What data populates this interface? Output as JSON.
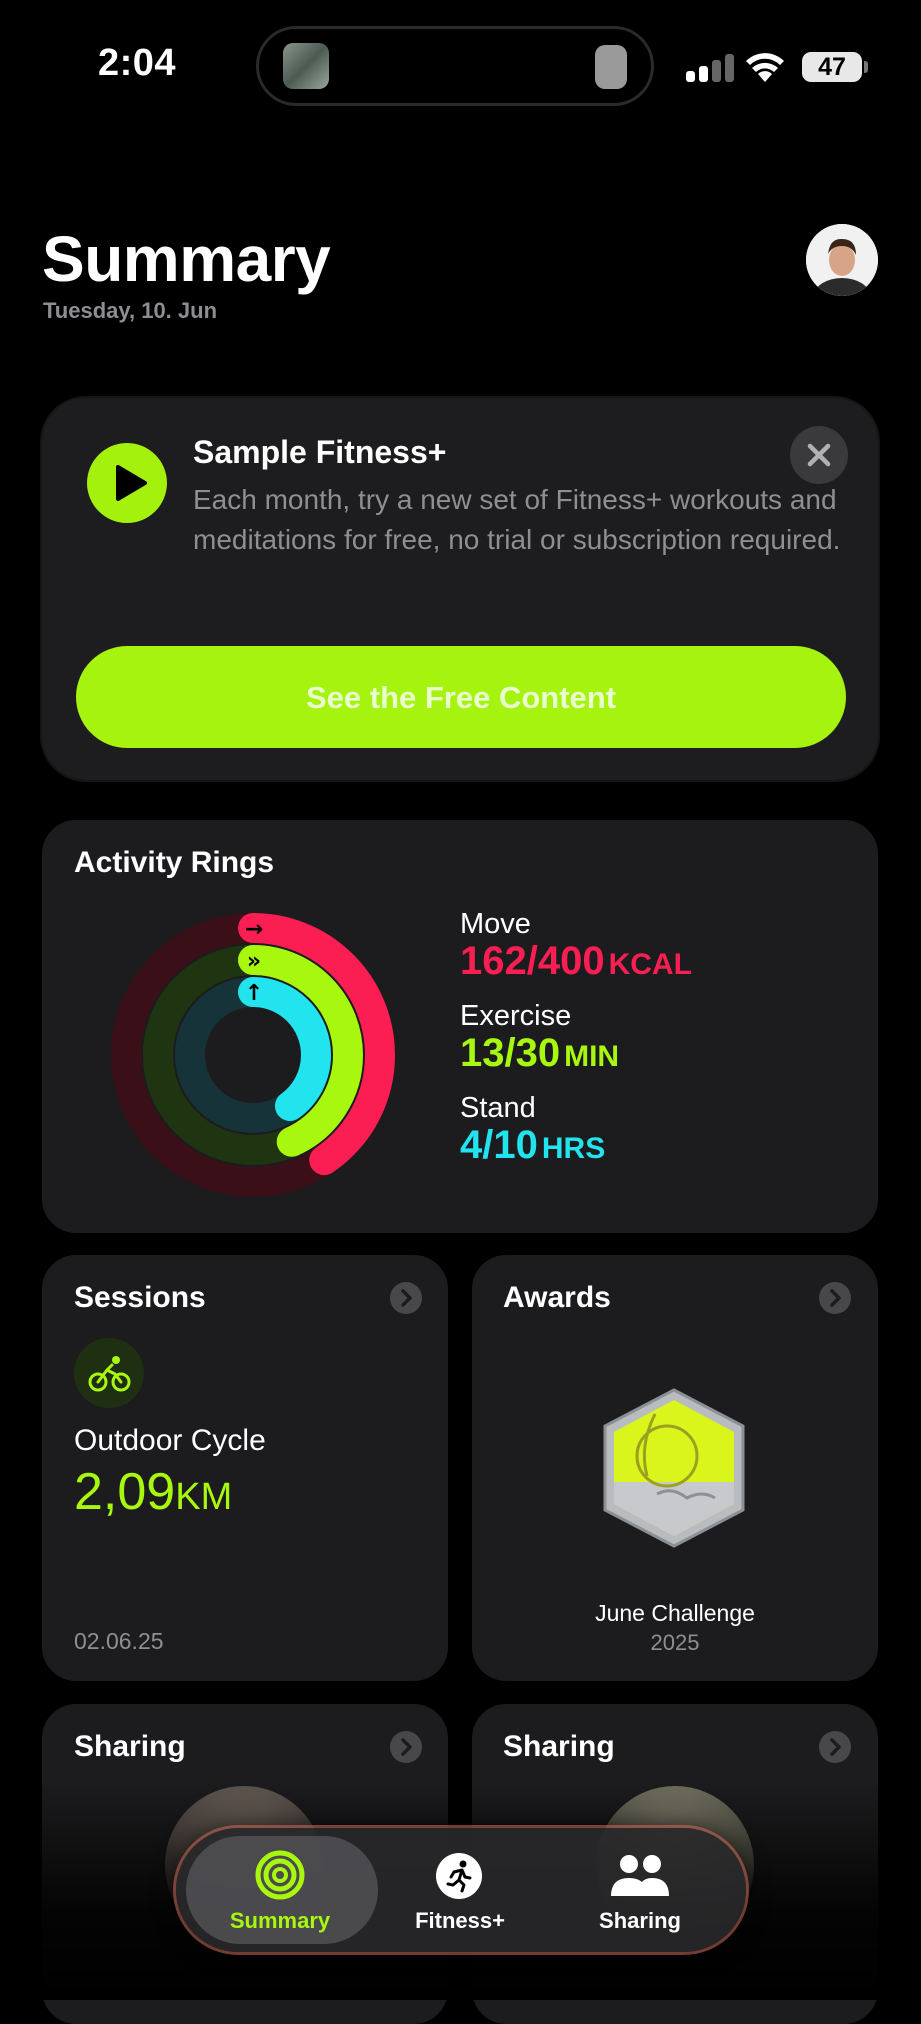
{
  "status_bar": {
    "time": "2:04",
    "battery": "47"
  },
  "header": {
    "title": "Summary",
    "date": "Tuesday, 10. Jun"
  },
  "promo": {
    "title": "Sample Fitness+",
    "description": "Each month, try a new set of Fitness+ workouts and meditations for free, no trial or subscription required.",
    "button_label": "See the Free Content"
  },
  "activity_rings": {
    "title": "Activity Rings",
    "move": {
      "label": "Move",
      "value": "162/400",
      "unit": "KCAL",
      "progress": 0.405,
      "color": "#fa1e52"
    },
    "exercise": {
      "label": "Exercise",
      "value": "13/30",
      "unit": "MIN",
      "progress": 0.433,
      "color": "#a8f70f"
    },
    "stand": {
      "label": "Stand",
      "value": "4/10",
      "unit": "HRS",
      "progress": 0.4,
      "color": "#22e4ee"
    }
  },
  "sessions": {
    "title": "Sessions",
    "workout": "Outdoor Cycle",
    "distance": "2,09",
    "unit": "KM",
    "date": "02.06.25"
  },
  "awards": {
    "title": "Awards",
    "award_name": "June Challenge",
    "award_year": "2025"
  },
  "sharing_left": {
    "title": "Sharing"
  },
  "sharing_right": {
    "title": "Sharing"
  },
  "tab_bar": {
    "tabs": [
      {
        "label": "Summary",
        "icon": "activity-rings-icon",
        "active": true
      },
      {
        "label": "Fitness+",
        "icon": "runner-icon",
        "active": false
      },
      {
        "label": "Sharing",
        "icon": "people-icon",
        "active": false
      }
    ]
  },
  "colors": {
    "accent": "#a5f30f",
    "card": "#1c1c1e",
    "secondary_text": "#8e8e93"
  }
}
